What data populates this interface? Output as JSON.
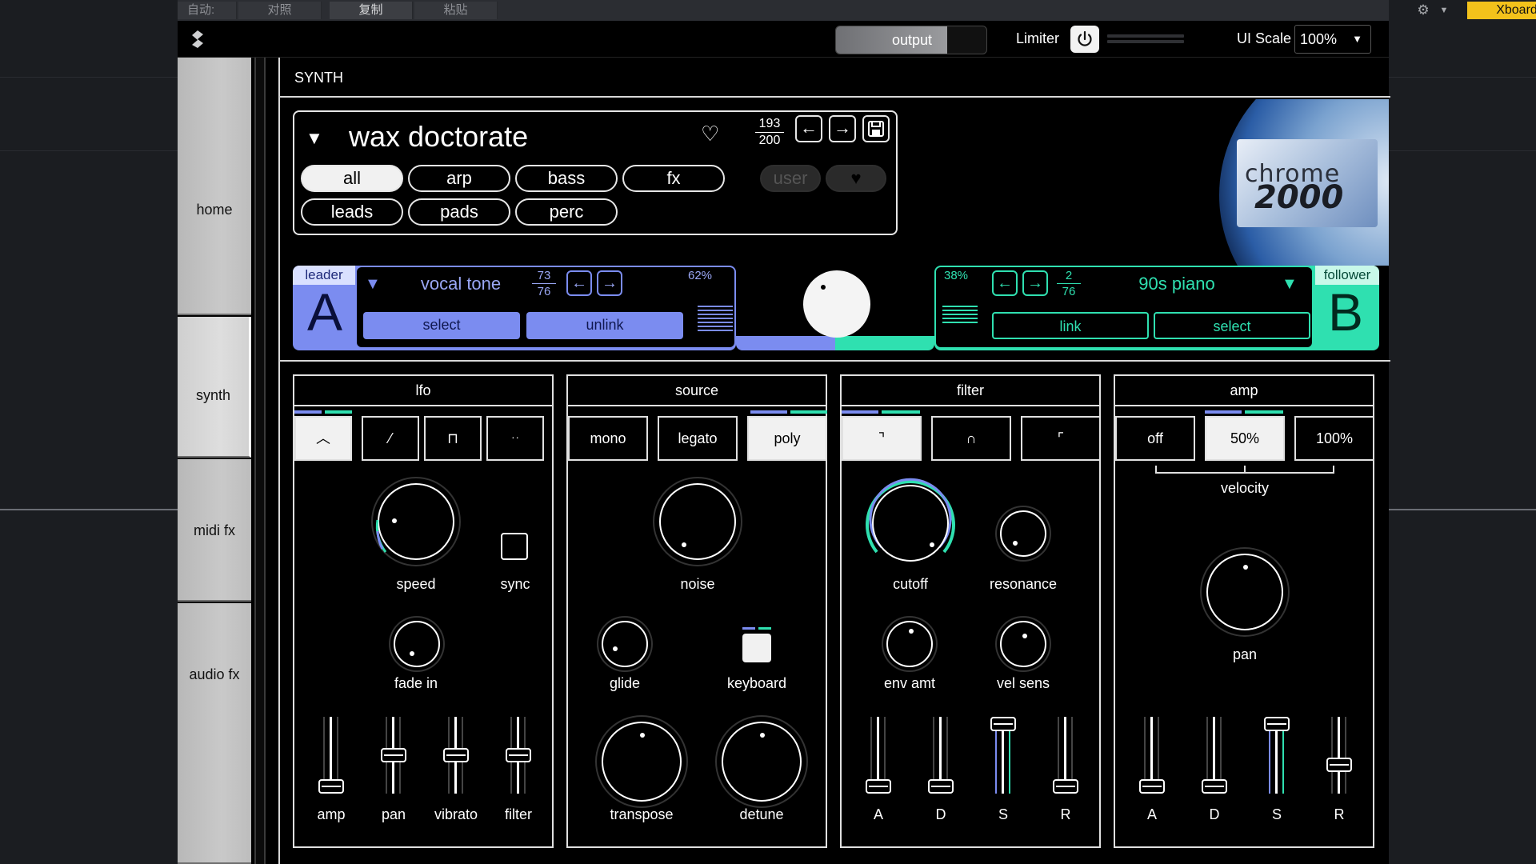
{
  "host": {
    "tabs": [
      "自动: 关",
      "对照",
      "复制",
      "粘贴"
    ],
    "preset_name": "Xboard"
  },
  "topbar": {
    "output_label": "output",
    "output_level": 0.74,
    "limiter_label": "Limiter",
    "ui_scale_label": "UI Scale",
    "ui_scale_value": "100%"
  },
  "nav": {
    "items": [
      {
        "label": "home"
      },
      {
        "label": "synth"
      },
      {
        "label": "midi fx"
      },
      {
        "label": "audio fx"
      }
    ],
    "selected": "synth"
  },
  "synth": {
    "header": "SYNTH",
    "preset": {
      "name": "wax doctorate",
      "index": "193",
      "total": "200",
      "filters": [
        "all",
        "arp",
        "bass",
        "fx",
        "leads",
        "pads",
        "perc"
      ],
      "active_filter": "all",
      "user_label": "user"
    },
    "art": {
      "line1": "chrome",
      "line2": "2000"
    },
    "leader": {
      "tag": "leader",
      "letter": "A",
      "name": "vocal tone",
      "index": "73",
      "total": "76",
      "mix": "62%",
      "select_label": "select",
      "unlink_label": "unlink",
      "color": "#7b8cf0"
    },
    "follower": {
      "tag": "follower",
      "letter": "B",
      "name": "90s piano",
      "index": "2",
      "total": "76",
      "mix": "38%",
      "link_label": "link",
      "select_label": "select",
      "color": "#2fe0b0"
    },
    "lfo": {
      "title": "lfo",
      "speed_label": "speed",
      "sync_label": "sync",
      "fade_label": "fade in",
      "faders": [
        {
          "label": "amp",
          "value": 0.0
        },
        {
          "label": "pan",
          "value": 0.5
        },
        {
          "label": "vibrato",
          "value": 0.5
        },
        {
          "label": "filter",
          "value": 0.5
        }
      ]
    },
    "source": {
      "title": "source",
      "modes": [
        "mono",
        "legato",
        "poly"
      ],
      "active_mode": "poly",
      "noise_label": "noise",
      "glide_label": "glide",
      "keyboard_label": "keyboard",
      "transpose_label": "transpose",
      "detune_label": "detune"
    },
    "filter": {
      "title": "filter",
      "cutoff_label": "cutoff",
      "resonance_label": "resonance",
      "env_label": "env amt",
      "vel_label": "vel sens",
      "faders": [
        {
          "label": "A",
          "value": 0.0
        },
        {
          "label": "D",
          "value": 0.0
        },
        {
          "label": "S",
          "value": 1.0
        },
        {
          "label": "R",
          "value": 0.0
        }
      ]
    },
    "amp": {
      "title": "amp",
      "velocity_options": [
        "off",
        "50%",
        "100%"
      ],
      "active_velocity": "50%",
      "velocity_label": "velocity",
      "pan_label": "pan",
      "faders": [
        {
          "label": "A",
          "value": 0.0
        },
        {
          "label": "D",
          "value": 0.0
        },
        {
          "label": "S",
          "value": 1.0
        },
        {
          "label": "R",
          "value": 0.35
        }
      ]
    }
  }
}
